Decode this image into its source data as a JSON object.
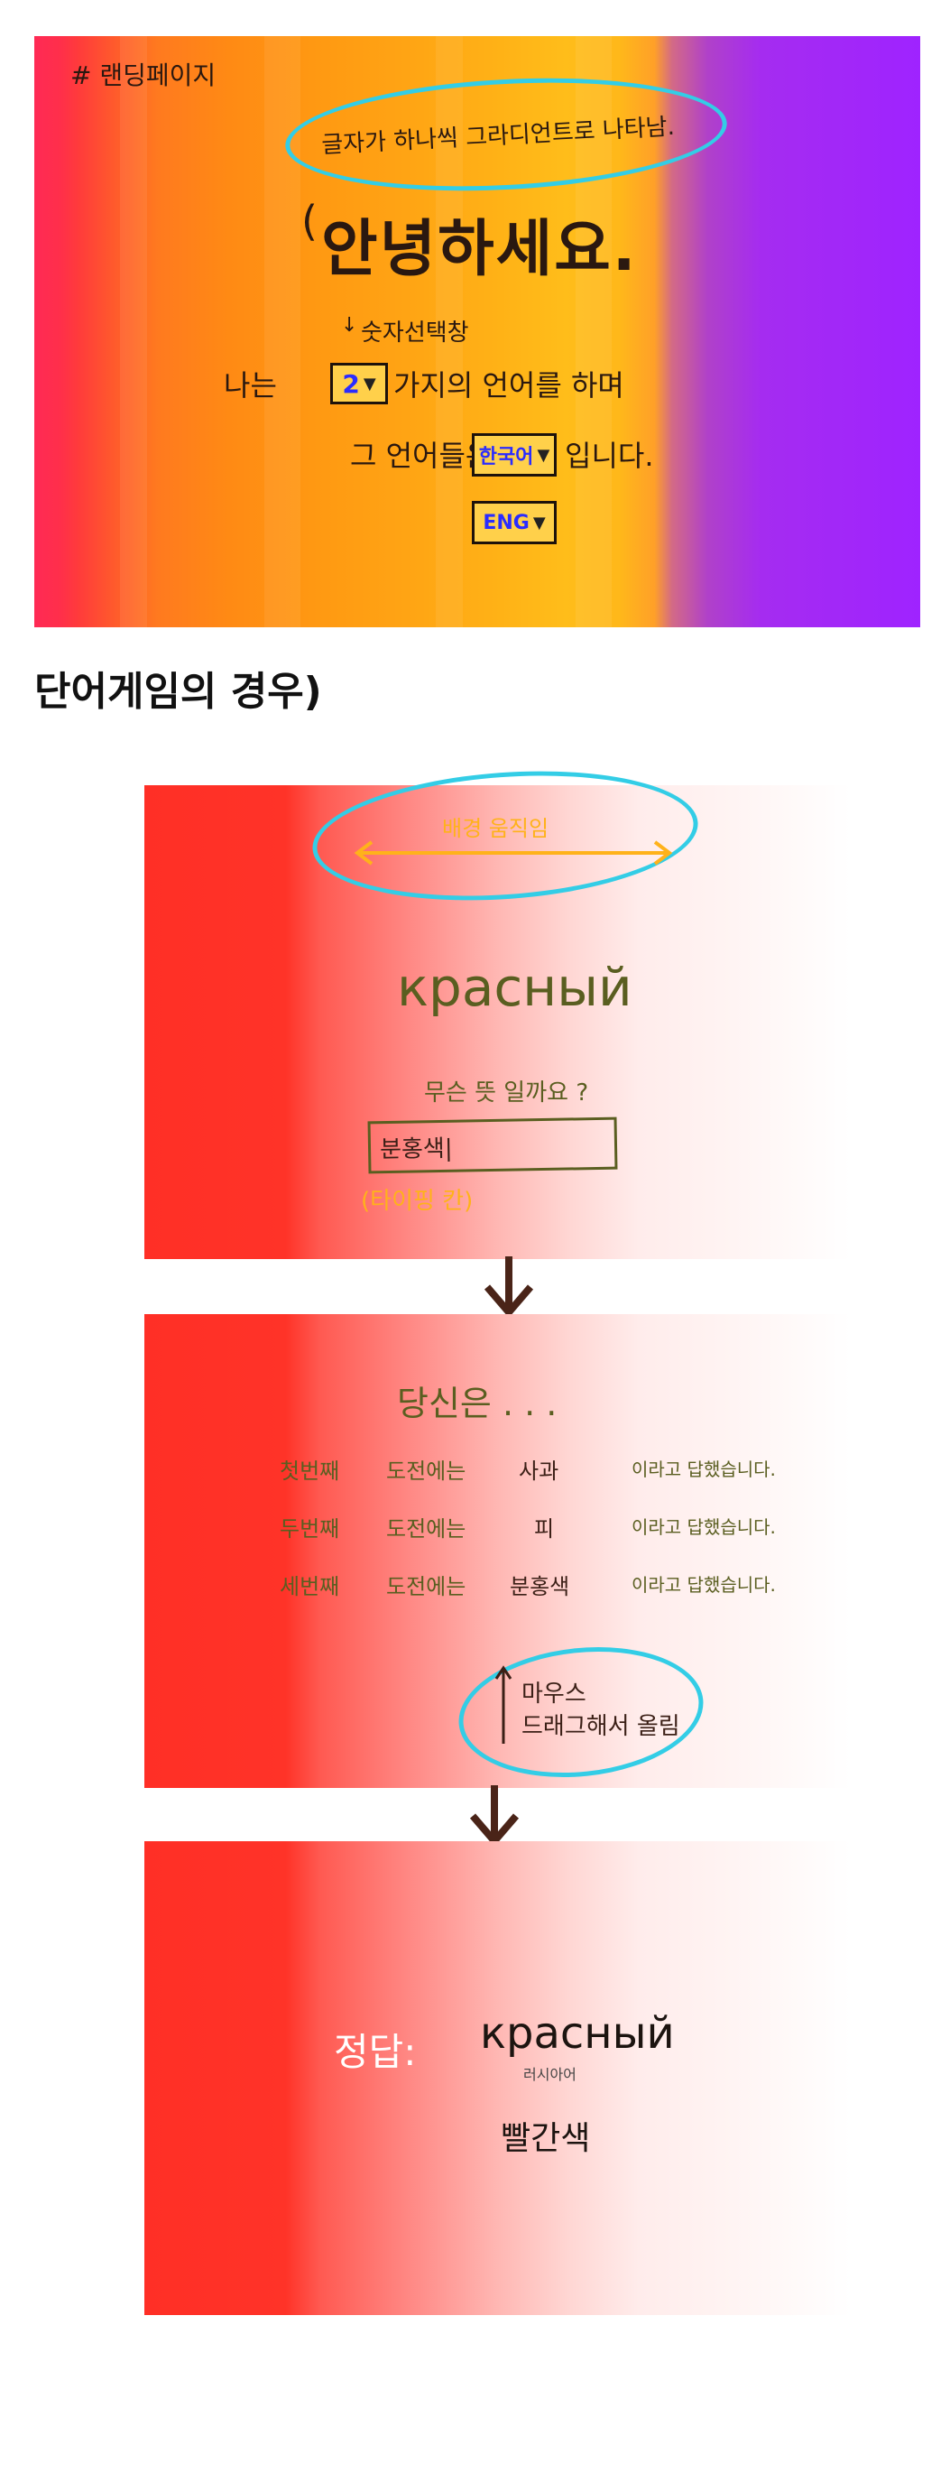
{
  "panel1": {
    "tag": "# 랜딩페이지",
    "note": "글자가 하나씩 그라디언트로 나타남.",
    "greeting": "안녕하세요.",
    "select_note": "숫자선택창",
    "line1_pre": "나는",
    "count_value": "2",
    "line1_post": "가지의 언어를 하며",
    "line2_pre": "그 언어들은",
    "lang1_value": "한국어",
    "line2_post": "입니다.",
    "lang2_value": "ENG"
  },
  "section_title": "단어게임의 경우)",
  "panel2": {
    "bg_note": "배경 움직임",
    "word": "красный",
    "question": "무슨 뜻 일까요 ?",
    "input_value": "분홍색|",
    "input_note": "(타이핑 칸)"
  },
  "panel3": {
    "heading": "당신은 . . .",
    "rows": [
      {
        "ordinal": "첫번째",
        "challenge": "도전에는",
        "answer": "사과",
        "suffix": "이라고 답했습니다."
      },
      {
        "ordinal": "두번째",
        "challenge": "도전에는",
        "answer": "피",
        "suffix": "이라고 답했습니다."
      },
      {
        "ordinal": "세번째",
        "challenge": "도전에는",
        "answer": "분홍색",
        "suffix": "이라고 답했습니다."
      }
    ],
    "drag_note_line1": "마우스",
    "drag_note_line2": "드래그해서 올림"
  },
  "panel4": {
    "answer_label": "정답:",
    "word": "красный",
    "language": "러시아어",
    "meaning": "빨간색"
  },
  "colors": {
    "ink": "#2a1810",
    "highlight": "#33cde6",
    "olive": "#5a5e20",
    "orange": "#ffb21a",
    "red": "#ff2f26"
  }
}
